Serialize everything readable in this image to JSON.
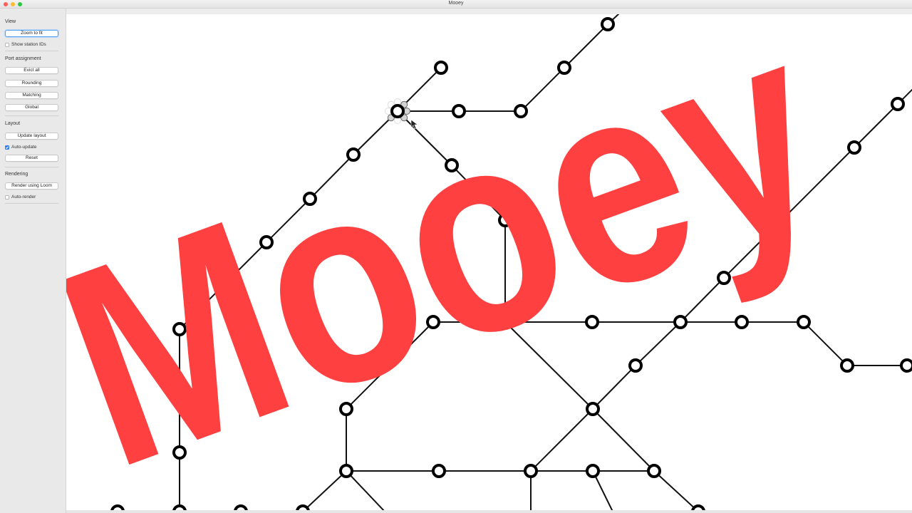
{
  "window": {
    "title": "Mooey"
  },
  "sidebar": {
    "view": {
      "title": "View",
      "zoom_to_fit": "Zoom to fit",
      "show_station_ids": "Show station IDs",
      "show_station_ids_checked": false
    },
    "port_assignment": {
      "title": "Port assignment",
      "evict_all": "Evict all",
      "rounding": "Rounding",
      "matching": "Matching",
      "global": "Global"
    },
    "layout": {
      "title": "Layout",
      "update_layout": "Update layout",
      "auto_update": "Auto-update",
      "auto_update_checked": true,
      "reset": "Reset"
    },
    "rendering": {
      "title": "Rendering",
      "render_using_loom": "Render using Loom",
      "auto_render": "Auto-render",
      "auto_render_checked": false
    }
  },
  "overlay": {
    "logo_text": "Mooey",
    "logo_color": "#ff4040"
  },
  "colors": {
    "line": "#111111",
    "station_fill": "#ffffff",
    "station_stroke": "#000000",
    "port_fill": "#d4d4d4"
  }
}
